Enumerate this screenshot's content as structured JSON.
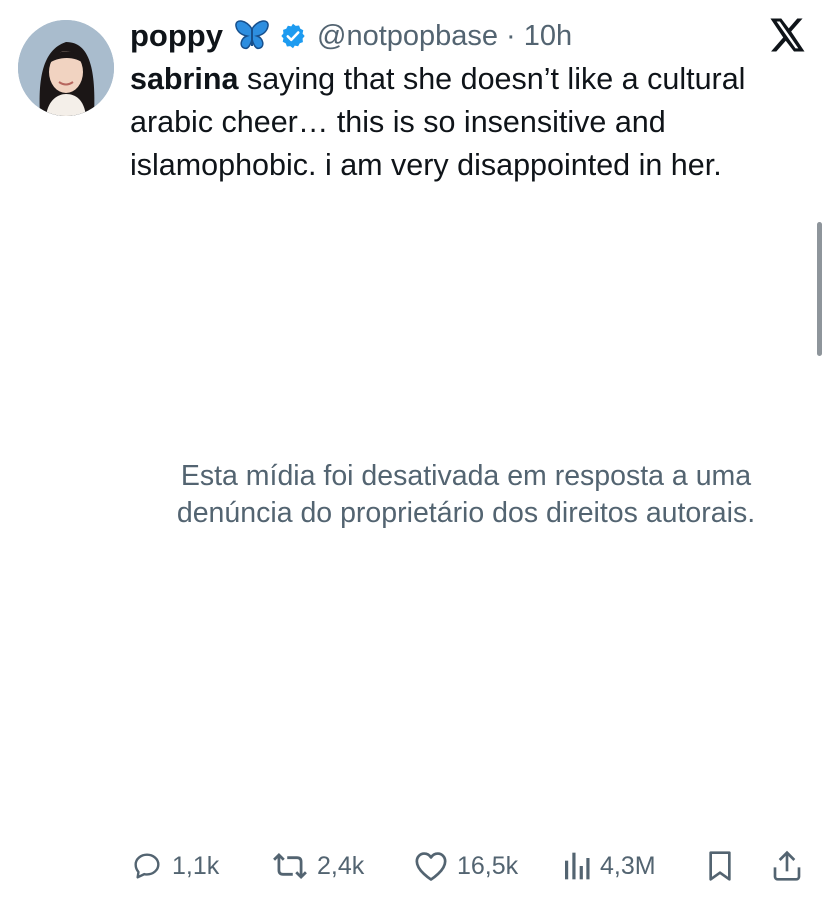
{
  "user": {
    "display_name": "poppy",
    "handle": "@notpopbase",
    "separator": "·",
    "time": "10h"
  },
  "tweet": {
    "mention": "sabrina",
    "text": " saying that she doesn’t like a cultural arabic cheer… this is so insensitive and islamophobic. i am very disappointed in her."
  },
  "media": {
    "notice": "Esta mídia foi desativada em resposta a uma denúncia do proprietário dos direitos autorais."
  },
  "actions": {
    "replies": "1,1k",
    "reposts": "2,4k",
    "likes": "16,5k",
    "views": "4,3M"
  },
  "colors": {
    "verified_badge": "#1d9bf0",
    "butterfly": "#2d8ee0",
    "secondary_text": "#536471",
    "primary_text": "#0f1419"
  },
  "icons": {
    "verified": "verified-badge-icon",
    "butterfly": "butterfly-emoji-icon",
    "logo": "x-logo-icon",
    "reply": "reply-bubble-icon",
    "repost": "repost-icon",
    "like": "heart-icon",
    "views": "views-bar-chart-icon",
    "bookmark": "bookmark-icon",
    "share": "share-icon"
  }
}
